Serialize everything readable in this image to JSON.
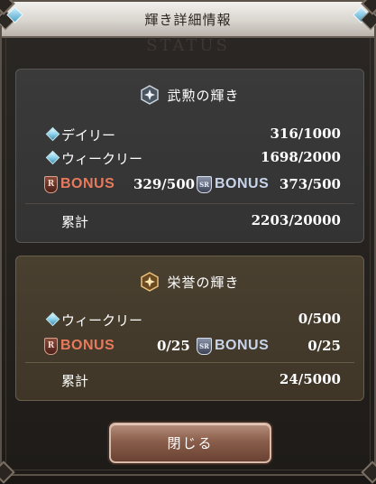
{
  "dialog": {
    "title": "輝き詳細情報",
    "watermark": "STATUS",
    "close_label": "閉じる"
  },
  "valor": {
    "title": "武勲の輝き",
    "daily_label": "デイリー",
    "daily_value": "316/1000",
    "weekly_label": "ウィークリー",
    "weekly_value": "1698/2000",
    "bonus_r_label": "BONUS",
    "bonus_r_tier": "R",
    "bonus_r_value": "329/500",
    "bonus_sr_label": "BONUS",
    "bonus_sr_tier": "SR",
    "bonus_sr_value": "373/500",
    "total_label": "累計",
    "total_value": "2203/20000"
  },
  "honor": {
    "title": "栄誉の輝き",
    "weekly_label": "ウィークリー",
    "weekly_value": "0/500",
    "bonus_r_label": "BONUS",
    "bonus_r_tier": "R",
    "bonus_r_value": "0/25",
    "bonus_sr_label": "BONUS",
    "bonus_sr_tier": "SR",
    "bonus_sr_value": "0/25",
    "total_label": "累計",
    "total_value": "24/5000"
  },
  "colors": {
    "valor_panel": "#363636",
    "honor_panel": "#453a2c",
    "bonus_r": "#e87a5c",
    "bonus_sr": "#c8d4ea",
    "diamond": "#8cd3ec"
  },
  "icons": {
    "valor": "silver-hexagon-star-icon",
    "honor": "gold-hexagon-star-icon",
    "row_marker": "diamond-icon",
    "bonus_r": "r-shield-icon",
    "bonus_sr": "sr-shield-icon"
  }
}
